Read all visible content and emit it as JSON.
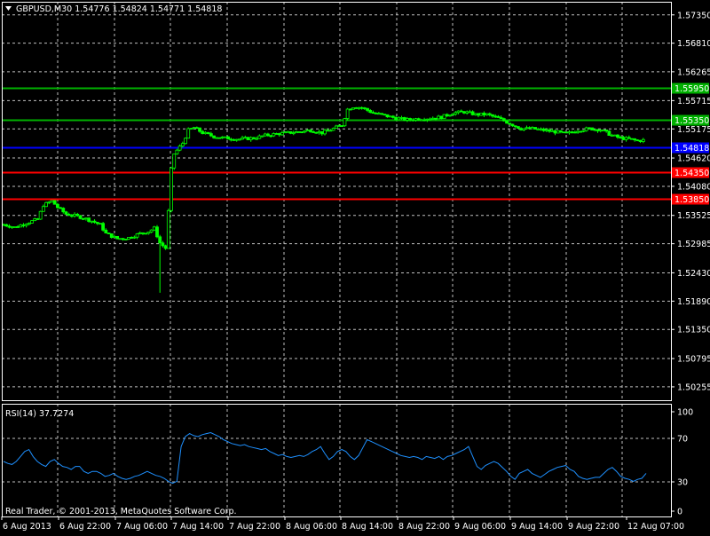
{
  "header": {
    "symbol_line": "GBPUSD,M30  1.54776 1.54824 1.54771 1.54818",
    "menu_arrow_icon": "triangle-down-icon"
  },
  "footer": {
    "copyright": "Real Trader, © 2001-2013, MetaQuotes Software Corp."
  },
  "colors": {
    "background": "#000000",
    "grid": "#c0c0c0",
    "bull_candle": "#00ff00",
    "bear_candle": "#00ff00",
    "rsi_line": "#1e90ff",
    "resistance": "#00b000",
    "current_price_line": "#0000ff",
    "support": "#ff0000"
  },
  "chart_data": [
    {
      "type": "candlestick",
      "title": "GBPUSD,M30",
      "ohlc_header": {
        "open": 1.54776,
        "high": 1.54824,
        "low": 1.54771,
        "close": 1.54818
      },
      "ylim": [
        1.5,
        1.576
      ],
      "y_ticks": [
        "1.57350",
        "1.56810",
        "1.56265",
        "1.55715",
        "1.55175",
        "1.54620",
        "1.54080",
        "1.53525",
        "1.52985",
        "1.52430",
        "1.51890",
        "1.51350",
        "1.50795",
        "1.50255"
      ],
      "x_labels": [
        "6 Aug 2013",
        "6 Aug 22:00",
        "7 Aug 06:00",
        "7 Aug 14:00",
        "7 Aug 22:00",
        "8 Aug 06:00",
        "8 Aug 14:00",
        "8 Aug 22:00",
        "9 Aug 06:00",
        "9 Aug 14:00",
        "9 Aug 22:00",
        "12 Aug 07:00"
      ],
      "price_levels": [
        {
          "label": "1.55950",
          "value": 1.5595,
          "color": "#00b000"
        },
        {
          "label": "1.55350",
          "value": 1.5535,
          "color": "#00b000"
        },
        {
          "label": "1.54818",
          "value": 1.54818,
          "color": "#0000ff"
        },
        {
          "label": "1.54350",
          "value": 1.5435,
          "color": "#ff0000"
        },
        {
          "label": "1.53850",
          "value": 1.5385,
          "color": "#ff0000"
        }
      ],
      "close_path": [
        [
          0,
          1.5335
        ],
        [
          4,
          1.533
        ],
        [
          8,
          1.5338
        ],
        [
          12,
          1.5345
        ],
        [
          14,
          1.5372
        ],
        [
          17,
          1.538
        ],
        [
          19,
          1.5368
        ],
        [
          22,
          1.5355
        ],
        [
          25,
          1.5352
        ],
        [
          28,
          1.5348
        ],
        [
          31,
          1.5342
        ],
        [
          34,
          1.5335
        ],
        [
          36,
          1.5318
        ],
        [
          40,
          1.5308
        ],
        [
          44,
          1.531
        ],
        [
          48,
          1.5318
        ],
        [
          51,
          1.5322
        ],
        [
          53,
          1.5328
        ],
        [
          55,
          1.53
        ],
        [
          57,
          1.529
        ],
        [
          58,
          1.536
        ],
        [
          59,
          1.544
        ],
        [
          60,
          1.547
        ],
        [
          63,
          1.549
        ],
        [
          65,
          1.5515
        ],
        [
          67,
          1.552
        ],
        [
          70,
          1.551
        ],
        [
          74,
          1.5503
        ],
        [
          78,
          1.55
        ],
        [
          83,
          1.5498
        ],
        [
          88,
          1.55
        ],
        [
          92,
          1.5505
        ],
        [
          96,
          1.5508
        ],
        [
          100,
          1.551
        ],
        [
          104,
          1.5512
        ],
        [
          108,
          1.5515
        ],
        [
          112,
          1.551
        ],
        [
          116,
          1.5518
        ],
        [
          119,
          1.5525
        ],
        [
          121,
          1.5555
        ],
        [
          123,
          1.556
        ],
        [
          126,
          1.5558
        ],
        [
          130,
          1.5548
        ],
        [
          134,
          1.5543
        ],
        [
          138,
          1.5538
        ],
        [
          142,
          1.5535
        ],
        [
          146,
          1.5537
        ],
        [
          150,
          1.5538
        ],
        [
          154,
          1.554
        ],
        [
          158,
          1.5548
        ],
        [
          162,
          1.555
        ],
        [
          166,
          1.5545
        ],
        [
          170,
          1.5545
        ],
        [
          174,
          1.5538
        ],
        [
          178,
          1.5528
        ],
        [
          182,
          1.5518
        ],
        [
          186,
          1.5518
        ],
        [
          190,
          1.5515
        ],
        [
          194,
          1.5512
        ],
        [
          198,
          1.5508
        ],
        [
          202,
          1.5515
        ],
        [
          206,
          1.5518
        ],
        [
          210,
          1.5516
        ],
        [
          214,
          1.5505
        ],
        [
          217,
          1.55
        ],
        [
          220,
          1.5498
        ],
        [
          223,
          1.5495
        ],
        [
          225,
          1.5496
        ]
      ],
      "spike_lows": [
        [
          55,
          1.5205
        ],
        [
          58,
          1.532
        ]
      ],
      "candle_count": 226
    },
    {
      "type": "line",
      "title": "RSI(14) 37.7274",
      "series_name": "RSI(14)",
      "last_value": 37.7274,
      "ylim": [
        0,
        100
      ],
      "y_ticks": [
        "100",
        "70",
        "30",
        "0"
      ],
      "levels": [
        70,
        30
      ],
      "values": [
        50,
        48,
        47,
        50,
        55,
        60,
        62,
        55,
        50,
        47,
        45,
        50,
        52,
        48,
        45,
        44,
        42,
        45,
        45,
        40,
        38,
        40,
        40,
        38,
        35,
        36,
        38,
        35,
        33,
        32,
        33,
        35,
        36,
        38,
        40,
        38,
        36,
        35,
        33,
        30,
        28,
        30,
        65,
        75,
        78,
        76,
        75,
        77,
        78,
        79,
        77,
        75,
        72,
        70,
        68,
        67,
        66,
        67,
        65,
        64,
        63,
        62,
        63,
        60,
        58,
        56,
        57,
        55,
        54,
        55,
        56,
        55,
        57,
        60,
        62,
        65,
        58,
        52,
        55,
        60,
        62,
        60,
        55,
        52,
        56,
        64,
        72,
        70,
        68,
        66,
        64,
        62,
        60,
        58,
        56,
        55,
        54,
        55,
        54,
        52,
        55,
        54,
        53,
        55,
        52,
        55,
        56,
        58,
        60,
        62,
        65,
        55,
        45,
        42,
        46,
        48,
        50,
        48,
        44,
        40,
        35,
        32,
        38,
        40,
        42,
        38,
        36,
        34,
        37,
        40,
        42,
        44,
        45,
        46,
        42,
        40,
        35,
        33,
        32,
        33,
        34,
        34,
        38,
        42,
        44,
        40,
        35,
        33,
        32,
        30,
        32,
        33,
        38
      ]
    }
  ]
}
